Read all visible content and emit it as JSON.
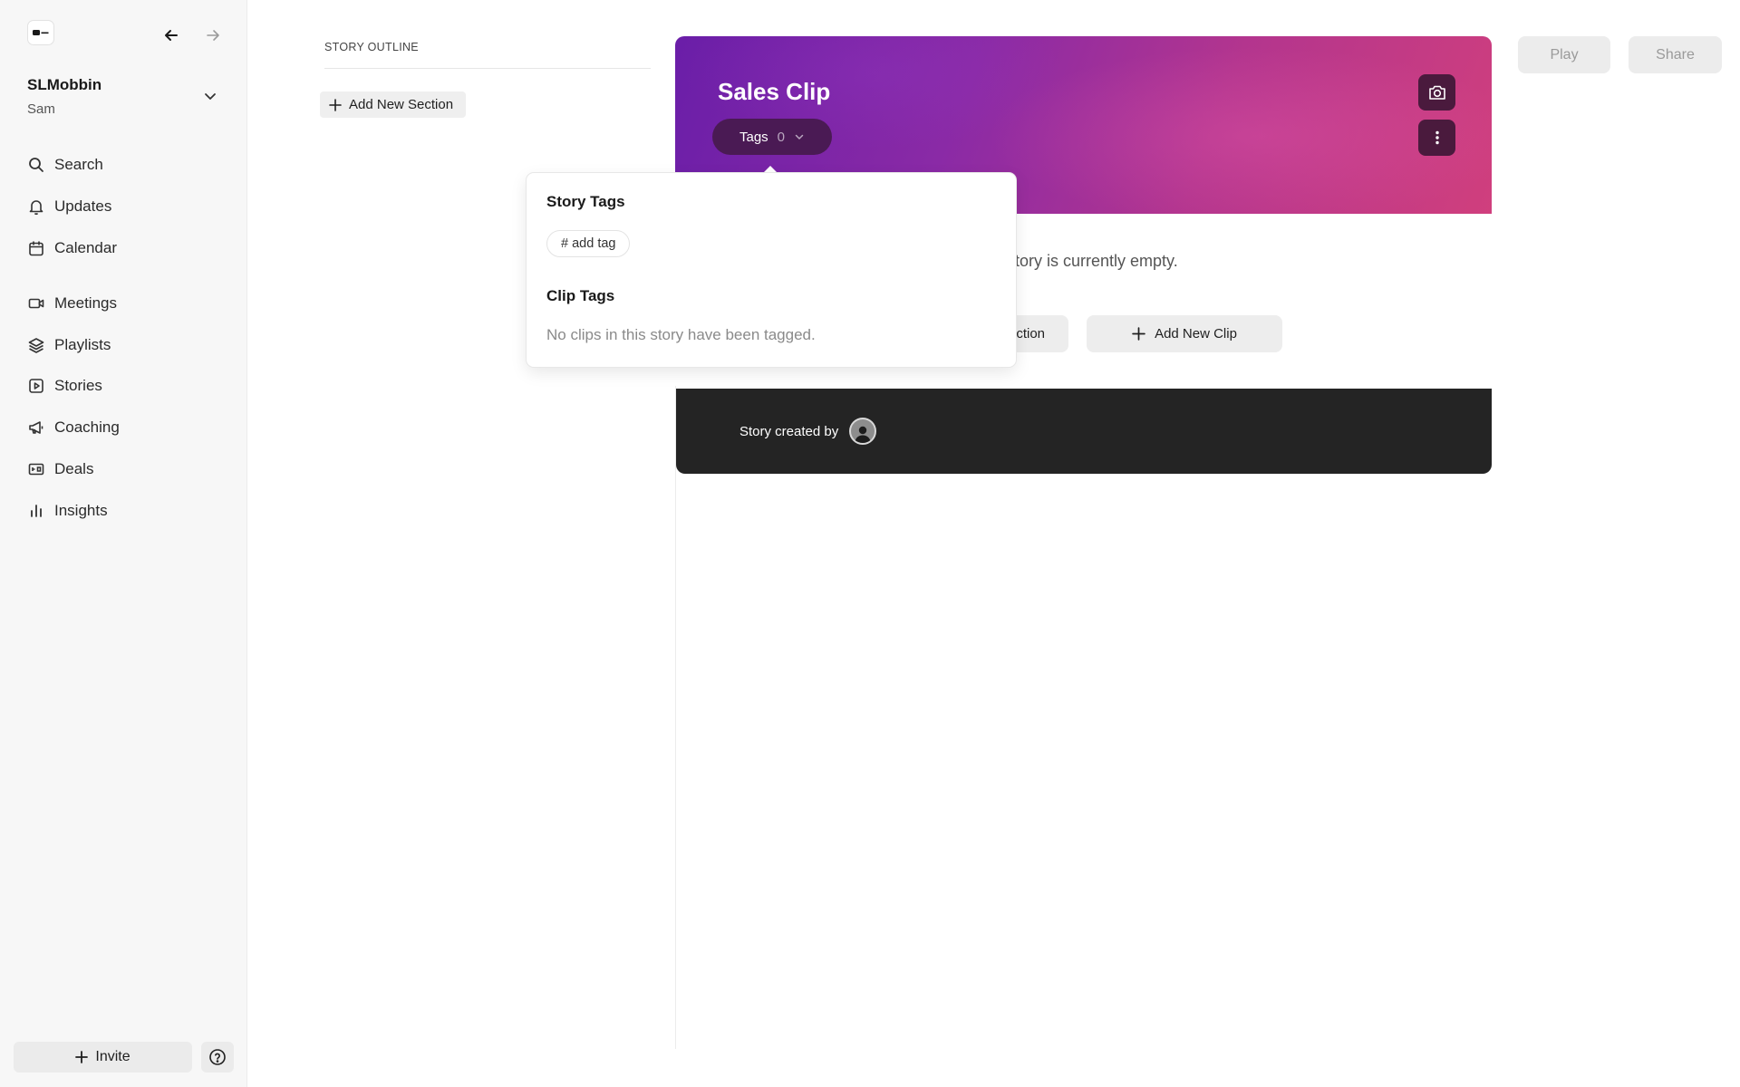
{
  "app": {
    "workspace_name": "SLMobbin",
    "user_name": "Sam"
  },
  "nav": {
    "items": [
      {
        "label": "Search",
        "icon": "search-icon"
      },
      {
        "label": "Updates",
        "icon": "bell-icon"
      },
      {
        "label": "Calendar",
        "icon": "calendar-icon"
      },
      {
        "label": "Meetings",
        "icon": "video-icon"
      },
      {
        "label": "Playlists",
        "icon": "layers-icon"
      },
      {
        "label": "Stories",
        "icon": "play-square-icon"
      },
      {
        "label": "Coaching",
        "icon": "megaphone-icon"
      },
      {
        "label": "Deals",
        "icon": "deal-icon"
      },
      {
        "label": "Insights",
        "icon": "bar-chart-icon"
      }
    ]
  },
  "footer_nav": {
    "invite_label": "Invite"
  },
  "outline": {
    "title": "STORY OUTLINE",
    "add_section_label": "Add New Section"
  },
  "toolbar": {
    "play_label": "Play",
    "share_label": "Share"
  },
  "story": {
    "title": "Sales Clip",
    "tags_label": "Tags",
    "tags_count": "0",
    "empty_message": "Story is currently empty.",
    "section_button_label": "ction",
    "add_clip_label": "Add New Clip",
    "created_by_label": "Story created by"
  },
  "tags_popover": {
    "story_tags_heading": "Story Tags",
    "add_tag_label": "# add tag",
    "clip_tags_heading": "Clip Tags",
    "clip_tags_empty": "No clips in this story have been tagged."
  },
  "colors": {
    "hero_gradient_start": "#6a1ea8",
    "hero_gradient_end": "#d03f7d",
    "tags_button": "#4a1a54",
    "footer_bg": "#242424",
    "sidebar_bg": "#f7f7f7"
  }
}
